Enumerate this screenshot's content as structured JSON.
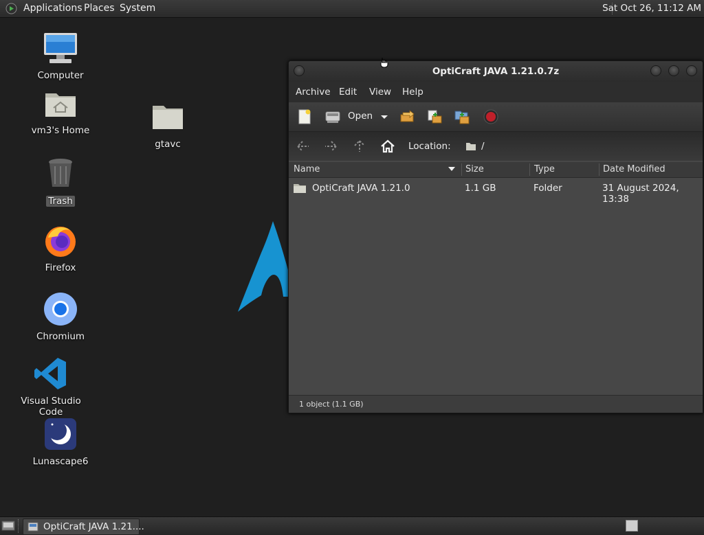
{
  "top_panel": {
    "menus": [
      "Applications",
      "Places",
      "System"
    ],
    "clock": "Sat Oct 26, 11:12 AM"
  },
  "desktop": {
    "icons": [
      {
        "label": "Computer",
        "icon": "computer-icon"
      },
      {
        "label": "vm3's Home",
        "icon": "home-folder-icon"
      },
      {
        "label": "gtavc",
        "icon": "folder-icon"
      },
      {
        "label": "Trash",
        "icon": "trash-icon"
      },
      {
        "label": "Firefox",
        "icon": "firefox-icon"
      },
      {
        "label": "Chromium",
        "icon": "chromium-icon"
      },
      {
        "label": "Visual Studio Code",
        "icon": "vscode-icon"
      },
      {
        "label": "Lunascape6",
        "icon": "lunascape-icon"
      }
    ]
  },
  "window": {
    "title": "OptiCraft JAVA 1.21.0.7z",
    "menu": [
      "Archive",
      "Edit",
      "View",
      "Help"
    ],
    "toolbar": {
      "open_label": "Open"
    },
    "location": {
      "label": "Location:",
      "path": "/"
    },
    "columns": [
      "Name",
      "Size",
      "Type",
      "Date Modified"
    ],
    "rows": [
      {
        "name": "OptiCraft JAVA 1.21.0",
        "size": "1.1 GB",
        "type": "Folder",
        "modified": "31 August 2024, 13:38"
      }
    ],
    "status": "1 object (1.1 GB)"
  },
  "taskbar": {
    "task_label": "OptiCraft JAVA 1.21...."
  },
  "colors": {
    "panel": "#2f2f2f",
    "desktop": "#1f1f1f",
    "window_bg": "#474747",
    "arch_blue": "#1793d1"
  }
}
